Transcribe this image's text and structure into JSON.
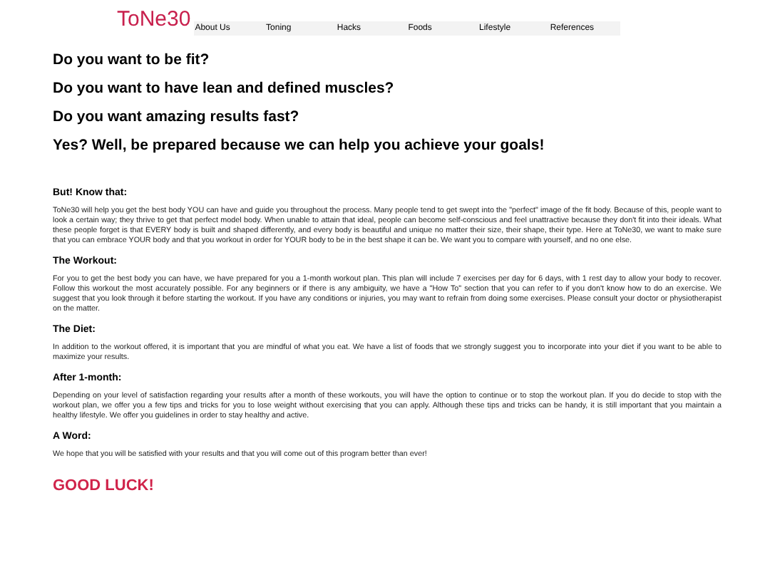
{
  "header": {
    "logo": "ToNe30",
    "nav": [
      "About Us",
      "Toning",
      "Hacks",
      "Foods",
      "Lifestyle",
      "References"
    ]
  },
  "headlines": [
    "Do you want to be fit?",
    "Do you want to have lean and defined muscles?",
    "Do you want amazing results fast?",
    "Yes? Well, be prepared because we can help you achieve your goals!"
  ],
  "sections": [
    {
      "heading": "But! Know that:",
      "text": "ToNe30 will help you get the best body YOU can have and guide you throughout the process. Many people tend to get swept into the \"perfect\" image of the fit body. Because of this, people want to look a certain way; they thrive to get that perfect model body. When unable to attain that ideal, people can become self-conscious and feel unattractive because they don't fit into their ideals. What these people forget is that EVERY body is built and shaped differently, and every body is beautiful and unique no matter their size, their shape, their type. Here at ToNe30, we want to make sure that you can embrace YOUR body and that you workout in order for YOUR body to be in the best shape it can be. We want you to compare with yourself, and no one else."
    },
    {
      "heading": "The Workout:",
      "text": "For you to get the best body you can have, we have prepared for you a 1-month workout plan. This plan will include 7 exercises per day for 6 days, with 1 rest day to allow your body to recover. Follow this workout the most accurately possible. For any beginners or if there is any ambiguity, we have a \"How To\" section that you can refer to if you don't know how to do an exercise. We suggest that you look through it before starting the workout. If you have any conditions or injuries, you may want to refrain from doing some exercises. Please consult your doctor or physiotherapist on the matter."
    },
    {
      "heading": "The Diet:",
      "text": "In addition to the workout offered, it is important that you are mindful of what you eat. We have a list of foods that we strongly suggest you to incorporate into your diet if you want to be able to maximize your results."
    },
    {
      "heading": "After 1-month:",
      "text": "Depending on your level of satisfaction regarding your results after a month of these workouts, you will have the option to continue or to stop the workout plan. If you do decide to stop with the workout plan, we offer you a few tips and tricks for you to lose weight without exercising that you can apply. Although these tips and tricks can be handy, it is still important that you maintain a healthy lifestyle. We offer you guidelines in order to stay healthy and active."
    },
    {
      "heading": "A Word:",
      "text": "We hope that you will be satisfied with your results and that you will come out of this program better than ever!"
    }
  ],
  "closing": "GOOD LUCK!"
}
